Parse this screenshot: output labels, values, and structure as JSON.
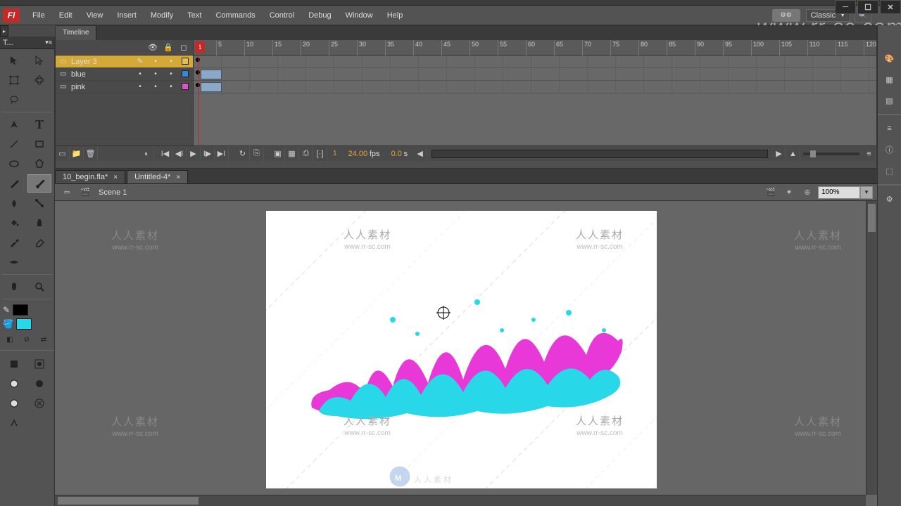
{
  "menu": [
    "File",
    "Edit",
    "View",
    "Insert",
    "Modify",
    "Text",
    "Commands",
    "Control",
    "Debug",
    "Window",
    "Help"
  ],
  "workspace": "Classic",
  "watermark_big": "www.rr-sc.com",
  "tools_tab": "T...",
  "timeline": {
    "tab": "Timeline",
    "ruler_start": 1,
    "layers": [
      {
        "name": "Layer 3",
        "color": "#e8c040",
        "active": true
      },
      {
        "name": "blue",
        "color": "#3388dd",
        "active": false
      },
      {
        "name": "pink",
        "color": "#dd55cc",
        "active": false
      }
    ],
    "current_frame": "1",
    "fps": "24.00",
    "fps_label": "fps",
    "elapsed": "0.0",
    "elapsed_label": "s"
  },
  "docs": [
    {
      "name": "10_begin.fla*",
      "active": false
    },
    {
      "name": "Untitled-4*",
      "active": true
    }
  ],
  "scene": {
    "name": "Scene 1",
    "zoom": "100%"
  },
  "colors": {
    "stroke": "#000000",
    "fill": "#28d8e8"
  },
  "canvas_wm": {
    "cn": "人人素材",
    "en": "www.rr-sc.com"
  }
}
